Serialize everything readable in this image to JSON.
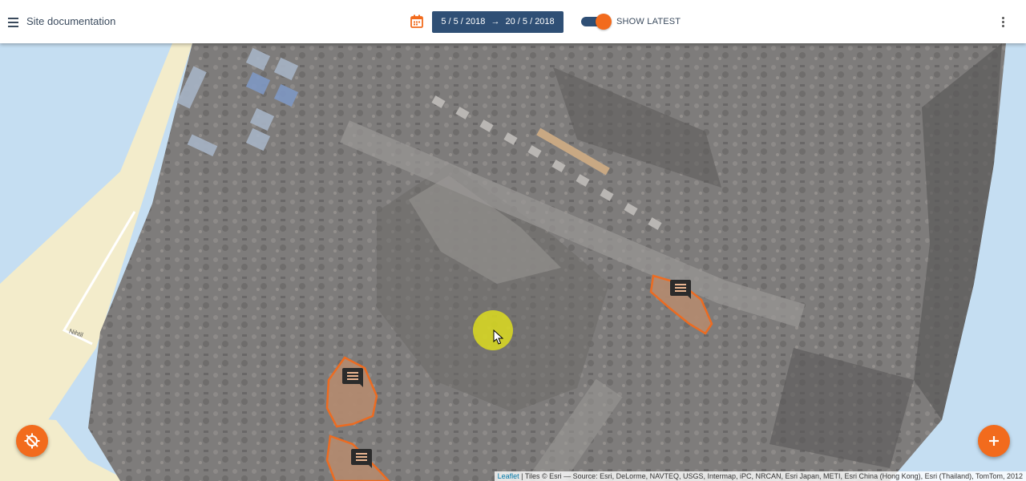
{
  "app": {
    "title": "Site documentation",
    "menu_icon": "hamburger-menu-icon",
    "more_icon": "more-vertical-icon"
  },
  "date_range": {
    "icon": "calendar-icon",
    "start": "5 / 5 / 2018",
    "arrow": "→",
    "end": "20 / 5 / 2018"
  },
  "toggle": {
    "label": "SHOW LATEST",
    "checked": true
  },
  "map": {
    "street_label": "Nihtil",
    "attribution_link": "Leaflet",
    "attribution_text": " | Tiles © Esri — Source: Esri, DeLorme, NAVTEQ, USGS, Intermap, iPC, NRCAN, Esri Japan, METI, Esri China (Hong Kong), Esri (Thailand), TomTom, 2012"
  },
  "fabs": {
    "left_icon": "location-disabled-icon",
    "right_icon": "plus-icon"
  },
  "markers": [
    {
      "icon": "comment-icon"
    },
    {
      "icon": "comment-icon"
    },
    {
      "icon": "comment-icon"
    }
  ],
  "colors": {
    "accent": "#f26b1d",
    "primary": "#2f4f75",
    "appbar_bg": "#ffffff"
  }
}
